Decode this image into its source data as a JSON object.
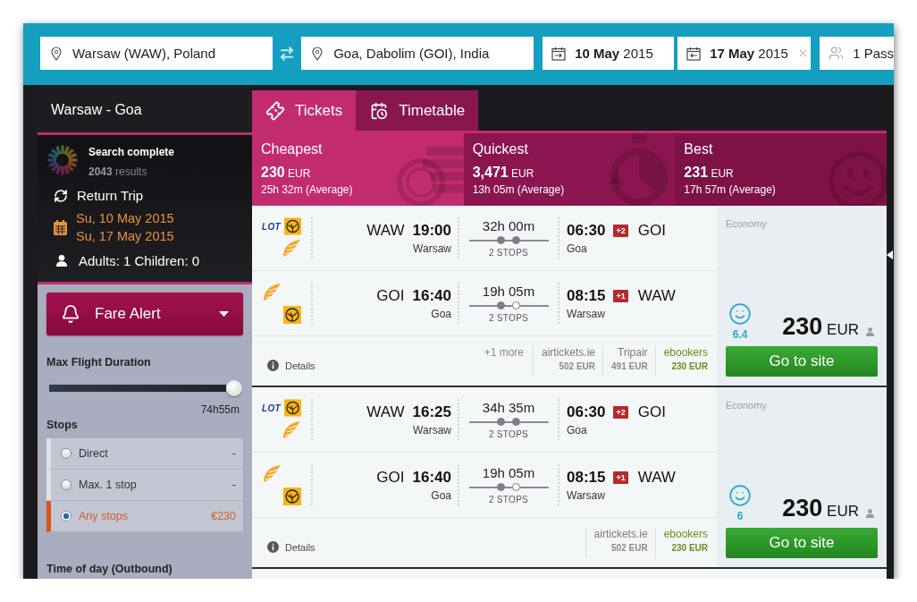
{
  "search_bar": {
    "origin": {
      "value": "Warsaw (WAW), Poland"
    },
    "destination": {
      "value": "Goa, Dabolim (GOI), India"
    },
    "dates": [
      {
        "value": "**10 May** 2015",
        "clearable": false
      },
      {
        "value": "**17 May** 2015",
        "clearable": true
      }
    ],
    "passengers": {
      "value": "1 Pass"
    }
  },
  "sidebar": {
    "route": "Warsaw - Goa",
    "status": {
      "title": "Search complete",
      "results": "**2043** results"
    },
    "trip_type": "Return Trip",
    "dates": [
      "Su, 10 May 2015",
      "Su, 17 May 2015"
    ],
    "travellers": "Adults: 1 Children: 0",
    "fare_alert": {
      "label": "Fare Alert"
    },
    "max_duration": {
      "title": "Max Flight Duration",
      "level": 1,
      "reading": "74h55m"
    },
    "stops": {
      "title": "Stops",
      "options": [
        {
          "label": "Direct",
          "price": "-",
          "selected": false
        },
        {
          "label": "Max. 1 stop",
          "price": "-",
          "selected": false
        },
        {
          "label": "Any stops",
          "price": "€230",
          "selected": true
        }
      ]
    },
    "time_of_day": {
      "title": "Time of day (Outbound)"
    }
  },
  "tabs": [
    {
      "label": "Tickets",
      "kind": "tickets",
      "selected": true
    },
    {
      "label": "Timetable",
      "kind": "timetable",
      "selected": false
    }
  ],
  "summary": [
    {
      "kind": "cheapest",
      "title": "Cheapest",
      "price": "230",
      "currency": "EUR",
      "duration": "25h 32m (Average)",
      "selected": true
    },
    {
      "kind": "quickest",
      "title": "Quickest",
      "price": "3,471",
      "currency": "EUR",
      "duration": "13h 05m (Average)",
      "selected": false
    },
    {
      "kind": "best",
      "title": "Best",
      "price": "231",
      "currency": "EUR",
      "duration": "17h 57m (Average)",
      "selected": false
    }
  ],
  "results": [
    {
      "legs": [
        {
          "carriers": [
            {
              "kind": "text",
              "text": "LOT"
            },
            {
              "kind": "crane"
            },
            {
              "kind": "swoosh"
            }
          ],
          "from_code": "WAW",
          "depart": "19:00",
          "from_city": "Warsaw",
          "duration": "32h 00m",
          "stops": [
            {
              "hollow": false
            },
            {
              "hollow": false
            }
          ],
          "stops_label": "2 STOPS",
          "arrive": "06:30",
          "day_offset": "+2",
          "to_code": "GOI",
          "to_city": "Goa"
        },
        {
          "carriers": [
            {
              "kind": "swoosh"
            },
            {
              "kind": "crane"
            }
          ],
          "from_code": "GOI",
          "depart": "16:40",
          "from_city": "Goa",
          "duration": "19h 05m",
          "stops": [
            {
              "hollow": false
            },
            {
              "hollow": true
            }
          ],
          "stops_label": "2 STOPS",
          "arrive": "08:15",
          "day_offset": "+1",
          "to_code": "WAW",
          "to_city": "Warsaw"
        }
      ],
      "details": "Details",
      "more": "+1 more",
      "providers": [
        {
          "name": "airtickets.ie",
          "price": "502 EUR",
          "highlighted": false
        },
        {
          "name": "Tripair",
          "price": "491 EUR",
          "highlighted": false
        },
        {
          "name": "ebookers",
          "price": "230 EUR",
          "highlighted": true
        }
      ],
      "cabin": "Economy",
      "score": "6.4",
      "price": "230",
      "currency": "EUR",
      "action": "Go to site"
    },
    {
      "legs": [
        {
          "carriers": [
            {
              "kind": "text",
              "text": "LOT"
            },
            {
              "kind": "crane"
            },
            {
              "kind": "swoosh"
            }
          ],
          "from_code": "WAW",
          "depart": "16:25",
          "from_city": "Warsaw",
          "duration": "34h 35m",
          "stops": [
            {
              "hollow": false
            },
            {
              "hollow": false
            }
          ],
          "stops_label": "2 STOPS",
          "arrive": "06:30",
          "day_offset": "+2",
          "to_code": "GOI",
          "to_city": "Goa"
        },
        {
          "carriers": [
            {
              "kind": "swoosh"
            },
            {
              "kind": "crane"
            }
          ],
          "from_code": "GOI",
          "depart": "16:40",
          "from_city": "Goa",
          "duration": "19h 05m",
          "stops": [
            {
              "hollow": false
            },
            {
              "hollow": true
            }
          ],
          "stops_label": "2 STOPS",
          "arrive": "08:15",
          "day_offset": "+1",
          "to_code": "WAW",
          "to_city": "Warsaw"
        }
      ],
      "details": "Details",
      "providers": [
        {
          "name": "airtickets.ie",
          "price": "502 EUR",
          "highlighted": false
        },
        {
          "name": "ebookers",
          "price": "230 EUR",
          "highlighted": true
        }
      ],
      "cabin": "Economy",
      "score": "6",
      "price": "230",
      "currency": "EUR",
      "action": "Go to site"
    }
  ]
}
